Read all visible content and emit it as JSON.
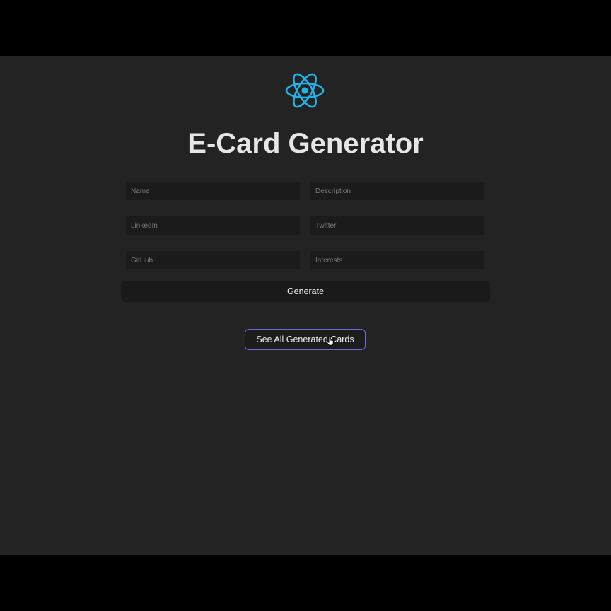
{
  "app": {
    "title": "E-Card Generator",
    "logo_icon": "react-atom-icon",
    "accent_color": "#22b4e8"
  },
  "form": {
    "fields": [
      {
        "name": "name",
        "placeholder": "Name",
        "value": ""
      },
      {
        "name": "description",
        "placeholder": "Description",
        "value": ""
      },
      {
        "name": "linkedin",
        "placeholder": "LinkedIn",
        "value": ""
      },
      {
        "name": "twitter",
        "placeholder": "Twitter",
        "value": ""
      },
      {
        "name": "github",
        "placeholder": "GitHub",
        "value": ""
      },
      {
        "name": "interests",
        "placeholder": "Interests",
        "value": ""
      }
    ],
    "generate_label": "Generate"
  },
  "actions": {
    "see_all_label": "See All Generated Cards",
    "see_all_border_color": "#6a6ad8"
  },
  "pointer": {
    "icon": "hand-pointer-icon"
  }
}
